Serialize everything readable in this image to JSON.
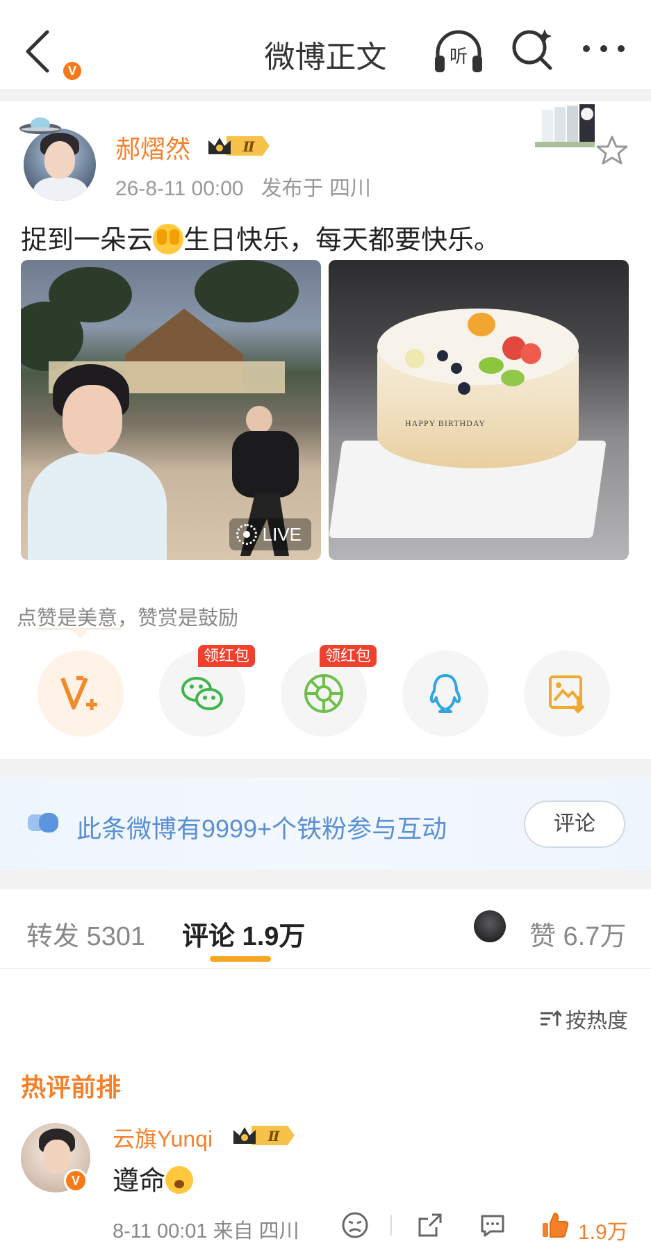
{
  "header": {
    "title": "微博正文",
    "listen_label": "听"
  },
  "post": {
    "author": "郝熠然",
    "rank_badge": "Ⅱ",
    "verified_mark": "V",
    "date": "26-8-11 00:00",
    "location": "发布于 四川",
    "text_before_emoji": "捉到一朵云",
    "text_after_emoji": "生日快乐，每天都要快乐。",
    "photo_live_label": "LIVE",
    "cake_text": "HAPPY BIRTHDAY"
  },
  "reward": {
    "prompt": "点赞是美意，赞赏是鼓励"
  },
  "share": {
    "redpack_label": "领红包"
  },
  "iron_fans": {
    "text": "此条微博有9999+个铁粉参与互动",
    "button": "评论"
  },
  "tabs": {
    "repost": "转发 5301",
    "comments": "评论 1.9万",
    "likes": "赞 6.7万"
  },
  "sort": {
    "label": "按热度"
  },
  "hot_comments": {
    "title": "热评前排",
    "items": [
      {
        "author": "云旗Yunqi",
        "rank_badge": "Ⅱ",
        "verified_mark": "V",
        "text": "遵命",
        "meta": "8-11 00:01 来自 四川",
        "likes": "1.9万"
      }
    ]
  },
  "colors": {
    "accent_orange": "#f5802a",
    "link_blue": "#5a8fd6",
    "redpack_red": "#f1402e",
    "tab_indicator": "#f6a623"
  }
}
